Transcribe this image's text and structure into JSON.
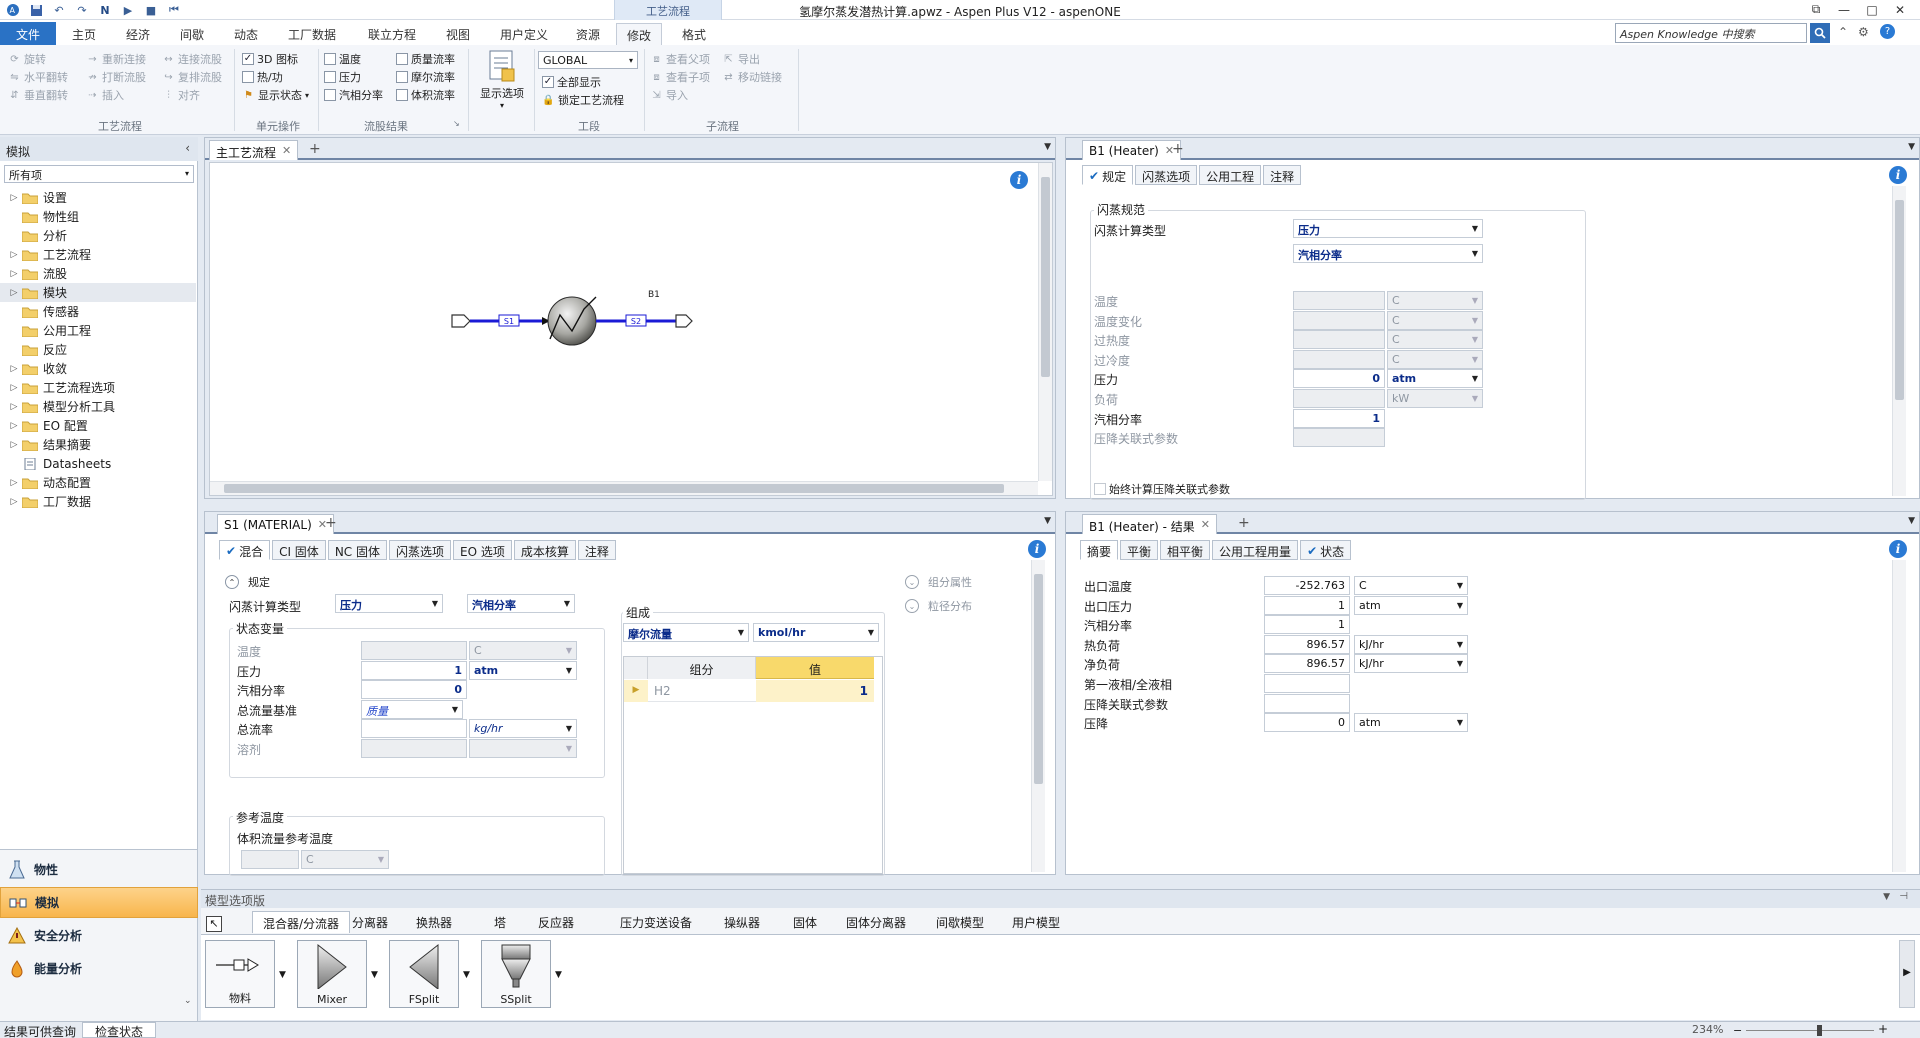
{
  "window": {
    "title": "氢摩尔蒸发潜热计算.apwz - Aspen Plus V12 - aspenONE",
    "context_tab_group": "工艺流程"
  },
  "ribbon": {
    "tabs": [
      "文件",
      "主页",
      "经济",
      "间歇",
      "动态",
      "工厂数据",
      "联立方程",
      "视图",
      "用户定义",
      "资源",
      "修改",
      "格式"
    ],
    "active_tab": "修改",
    "search_placeholder": "Aspen Knowledge 中搜索",
    "groups": {
      "flowsheet": {
        "label": "工艺流程",
        "items": [
          "旋转",
          "水平翻转",
          "垂直翻转",
          "重新连接",
          "打断流股",
          "插入",
          "连接流股",
          "复排流股",
          "对齐"
        ]
      },
      "unit_ops": {
        "label": "单元操作",
        "items": [
          "3D 图标",
          "热/功",
          "显示状态"
        ]
      },
      "stream_results": {
        "label": "流股结果",
        "items": [
          "温度",
          "压力",
          "汽相分率",
          "质量流率",
          "摩尔流率",
          "体积流率"
        ]
      },
      "display_options": {
        "label": "显示选项"
      },
      "sections": {
        "label": "工段",
        "combo_value": "GLOBAL",
        "items": [
          "全部显示",
          "锁定工艺流程"
        ]
      },
      "subflowsheet": {
        "label": "子流程",
        "items": [
          "查看父项",
          "查看子项",
          "导入",
          "导出",
          "移动链接"
        ]
      }
    }
  },
  "nav": {
    "header": "模拟",
    "filter": "所有项",
    "tree": [
      {
        "label": "设置",
        "expand": true
      },
      {
        "label": "物性组",
        "expand": false
      },
      {
        "label": "分析",
        "expand": false
      },
      {
        "label": "工艺流程",
        "expand": true
      },
      {
        "label": "流股",
        "expand": true
      },
      {
        "label": "模块",
        "expand": true,
        "selected": true
      },
      {
        "label": "传感器",
        "expand": false
      },
      {
        "label": "公用工程",
        "expand": false
      },
      {
        "label": "反应",
        "expand": false
      },
      {
        "label": "收敛",
        "expand": true
      },
      {
        "label": "工艺流程选项",
        "expand": true
      },
      {
        "label": "模型分析工具",
        "expand": true
      },
      {
        "label": "EO 配置",
        "expand": true
      },
      {
        "label": "结果摘要",
        "expand": true
      },
      {
        "label": "Datasheets",
        "expand": false
      },
      {
        "label": "动态配置",
        "expand": true
      },
      {
        "label": "工厂数据",
        "expand": true
      }
    ],
    "bottom": [
      {
        "label": "物性",
        "icon": "flask-icon"
      },
      {
        "label": "模拟",
        "icon": "flowsheet-icon",
        "active": true
      },
      {
        "label": "安全分析",
        "icon": "safety-icon"
      },
      {
        "label": "能量分析",
        "icon": "energy-icon"
      }
    ]
  },
  "flowsheet_panel": {
    "tab": "主工艺流程",
    "block_label": "B1",
    "stream_in": "S1",
    "stream_out": "S2"
  },
  "b1_input": {
    "tab": "B1 (Heater)",
    "subtabs": [
      "规定",
      "闪蒸选项",
      "公用工程",
      "注释"
    ],
    "group_title": "闪蒸规范",
    "flash_type_label": "闪蒸计算类型",
    "flash_spec1": "压力",
    "flash_spec2": "汽相分率",
    "rows": [
      {
        "label": "温度",
        "value": "",
        "unit": "C",
        "enabled": false
      },
      {
        "label": "温度变化",
        "value": "",
        "unit": "C",
        "enabled": false
      },
      {
        "label": "过热度",
        "value": "",
        "unit": "C",
        "enabled": false
      },
      {
        "label": "过冷度",
        "value": "",
        "unit": "C",
        "enabled": false
      },
      {
        "label": "压力",
        "value": "0",
        "unit": "atm",
        "enabled": true
      },
      {
        "label": "负荷",
        "value": "",
        "unit": "kW",
        "enabled": false
      },
      {
        "label": "汽相分率",
        "value": "1",
        "unit": "",
        "enabled": true
      },
      {
        "label": "压降关联式参数",
        "value": "",
        "unit": "",
        "enabled": false
      }
    ],
    "checkbox_label": "始终计算压降关联式参数"
  },
  "s1_panel": {
    "tab": "S1 (MATERIAL)",
    "subtabs": [
      "混合",
      "CI 固体",
      "NC 固体",
      "闪蒸选项",
      "EO 选项",
      "成本核算",
      "注释"
    ],
    "spec_header": "规定",
    "flash_type_label": "闪蒸计算类型",
    "flash_spec1": "压力",
    "flash_spec2": "汽相分率",
    "state_group": "状态变量",
    "rows": [
      {
        "label": "温度",
        "value": "",
        "unit": "C",
        "enabled": false
      },
      {
        "label": "压力",
        "value": "1",
        "unit": "atm",
        "enabled": true
      },
      {
        "label": "汽相分率",
        "value": "0",
        "unit": "",
        "enabled": true
      },
      {
        "label": "总流量基准",
        "value": "质量",
        "unit": "",
        "enabled": true
      },
      {
        "label": "总流率",
        "value": "",
        "unit": "kg/hr",
        "enabled": true
      },
      {
        "label": "溶剂",
        "value": "",
        "unit": "",
        "enabled": false
      }
    ],
    "ref_group": "参考温度",
    "ref_label": "体积流量参考温度",
    "ref_unit": "C",
    "comp_group": "组成",
    "comp_basis": "摩尔流量",
    "comp_unit": "kmol/hr",
    "comp_headers": [
      "组分",
      "值"
    ],
    "comp_rows": [
      {
        "component": "H2",
        "value": "1"
      }
    ],
    "side_links": [
      "组分属性",
      "粒径分布"
    ]
  },
  "b1_results": {
    "tab": "B1 (Heater) - 结果",
    "subtabs": [
      "摘要",
      "平衡",
      "相平衡",
      "公用工程用量",
      "状态"
    ],
    "rows": [
      {
        "label": "出口温度",
        "value": "-252.763",
        "unit": "C"
      },
      {
        "label": "出口压力",
        "value": "1",
        "unit": "atm"
      },
      {
        "label": "汽相分率",
        "value": "1",
        "unit": ""
      },
      {
        "label": "热负荷",
        "value": "896.57",
        "unit": "kJ/hr"
      },
      {
        "label": "净负荷",
        "value": "896.57",
        "unit": "kJ/hr"
      },
      {
        "label": "第一液相/全液相",
        "value": "",
        "unit": ""
      },
      {
        "label": "压降关联式参数",
        "value": "",
        "unit": ""
      },
      {
        "label": "压降",
        "value": "0",
        "unit": "atm"
      }
    ]
  },
  "palette": {
    "title": "模型选项版",
    "tabs": [
      "混合器/分流器",
      "分离器",
      "换热器",
      "塔",
      "反应器",
      "压力变送设备",
      "操纵器",
      "固体",
      "固体分离器",
      "间歇模型",
      "用户模型"
    ],
    "active_tab": "混合器/分流器",
    "items": [
      "物料",
      "Mixer",
      "FSplit",
      "SSplit"
    ]
  },
  "statusbar": {
    "left": "结果可供查询",
    "button": "检查状态",
    "zoom": "234%"
  }
}
